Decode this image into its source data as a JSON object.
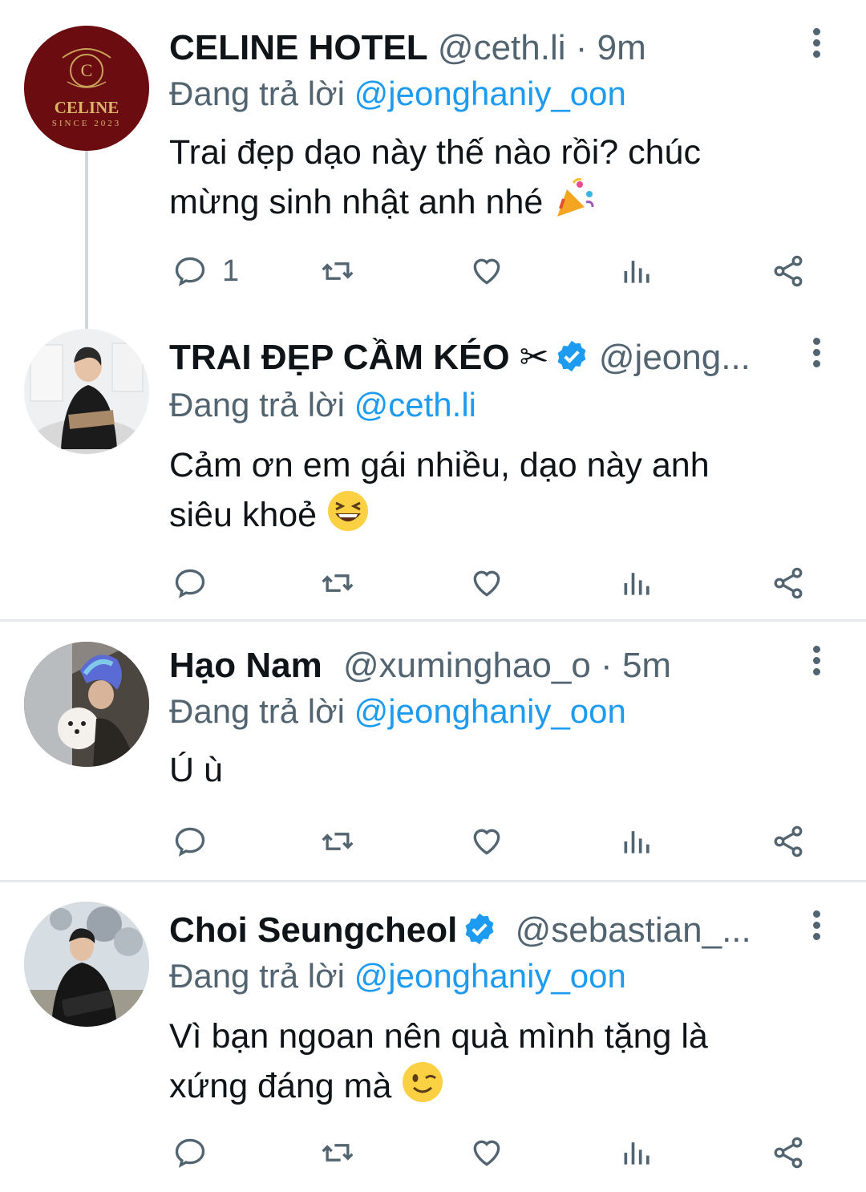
{
  "reply_prefix": "Đang trả lời",
  "tweets": [
    {
      "name": "CELINE HOTEL",
      "handle": "@ceth.li",
      "time": "9m",
      "reply_to": "@jeonghaniy_oon",
      "text_line1": "Trai đẹp dạo này thế nào rồi? chúc",
      "text_line2": "mừng sinh nhật anh nhé",
      "reply_count": "1",
      "avatar_text": "CELINE",
      "avatar_sub": "SINCE 2023"
    },
    {
      "name": "TRAI ĐẸP CẦM KÉO ✂",
      "handle": "@jeong...",
      "reply_to": "@ceth.li",
      "text_line1": "Cảm ơn em gái nhiều, dạo này anh",
      "text_line2": "siêu khoẻ",
      "reply_count": ""
    },
    {
      "name": "Hạo Nam",
      "handle": "@xuminghao_o",
      "time": "5m",
      "reply_to": "@jeonghaniy_oon",
      "text_line1": "Ú ù",
      "text_line2": "",
      "reply_count": ""
    },
    {
      "name": "Choi Seungcheol",
      "handle": "@sebastian_...",
      "reply_to": "@jeonghaniy_oon",
      "text_line1": "Vì bạn ngoan nên quà mình tặng là",
      "text_line2": "xứng đáng mà",
      "reply_count": ""
    }
  ],
  "colors": {
    "mention": "#1d9bf0",
    "muted": "#536471",
    "divider": "#e7eaec"
  },
  "icons": [
    "reply-icon",
    "retweet-icon",
    "like-icon",
    "views-icon",
    "share-icon",
    "more-icon",
    "verified-icon"
  ]
}
